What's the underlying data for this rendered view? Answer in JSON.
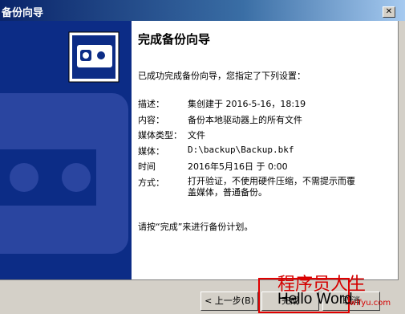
{
  "window": {
    "title": "备份向导",
    "close_glyph": "✕"
  },
  "main": {
    "heading": "完成备份向导",
    "intro": "已成功完成备份向导，您指定了下列设置：",
    "settings": [
      {
        "key": "描述：",
        "value": "集创建于 2016-5-16，18:19"
      },
      {
        "key": "内容：",
        "value": "备份本地驱动器上的所有文件"
      },
      {
        "key": "媒体类型：",
        "value": "文件"
      },
      {
        "key": "媒体：",
        "value": "D:\\backup\\Backup.bkf"
      },
      {
        "key": "时间",
        "value": "2016年5月16日 于 0:00"
      },
      {
        "key": "方式：",
        "value": "打开验证，不使用硬件压缩，不需提示而覆盖媒体，普通备份。"
      }
    ],
    "footer_note": "请按“完成”来进行备份计划。"
  },
  "buttons": {
    "back": "< 上一步(B)",
    "finish": "完成",
    "cancel": "取消"
  },
  "watermark": {
    "title": "程序员人生",
    "text": "Hello Word",
    "url": "wlfyu.com"
  },
  "icons": {
    "wizard": "backup-tape-icon"
  },
  "colors": {
    "panel": "#0c2c86",
    "titlebar": "#0a246a"
  }
}
